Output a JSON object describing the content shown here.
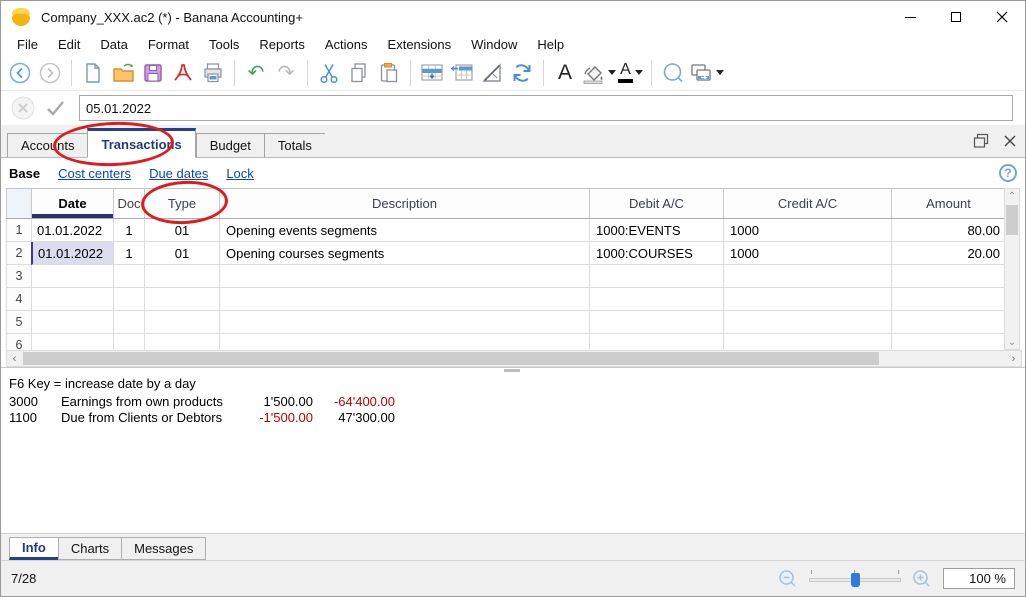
{
  "window": {
    "title": "Company_XXX.ac2 (*) - Banana Accounting+"
  },
  "menu": {
    "items": [
      "File",
      "Edit",
      "Data",
      "Format",
      "Tools",
      "Reports",
      "Actions",
      "Extensions",
      "Window",
      "Help"
    ]
  },
  "toolbar": {
    "font_label": "A",
    "font_color_label": "A"
  },
  "icons": {
    "undo": "↶",
    "redo": "↷",
    "scroll_up": "⌃",
    "scroll_down": "⌄",
    "scroll_left": "‹",
    "scroll_right": "›",
    "help": "?"
  },
  "edit_bar": {
    "value": "05.01.2022"
  },
  "main_tabs": {
    "active": "Transactions",
    "items": [
      {
        "label": "Accounts"
      },
      {
        "label": "Transactions"
      },
      {
        "label": "Budget"
      },
      {
        "label": "Totals"
      }
    ]
  },
  "views_bar": {
    "active": "Base",
    "links": [
      {
        "label": "Cost centers"
      },
      {
        "label": "Due dates"
      },
      {
        "label": "Lock"
      }
    ]
  },
  "transactions_table": {
    "columns": {
      "date": "Date",
      "doc": "Doc",
      "type": "Type",
      "description": "Description",
      "debit": "Debit A/C",
      "credit": "Credit A/C",
      "amount": "Amount"
    },
    "rows": [
      {
        "num": "1",
        "date": "01.01.2022",
        "doc": "1",
        "type": "01",
        "description": "Opening events segments",
        "debit": "1000:EVENTS",
        "credit": "1000",
        "amount": "80.00"
      },
      {
        "num": "2",
        "date": "01.01.2022",
        "doc": "1",
        "type": "01",
        "description": "Opening courses segments",
        "debit": "1000:COURSES",
        "credit": "1000",
        "amount": "20.00"
      },
      {
        "num": "3",
        "date": "",
        "doc": "",
        "type": "",
        "description": "",
        "debit": "",
        "credit": "",
        "amount": ""
      },
      {
        "num": "4",
        "date": "",
        "doc": "",
        "type": "",
        "description": "",
        "debit": "",
        "credit": "",
        "amount": ""
      },
      {
        "num": "5",
        "date": "",
        "doc": "",
        "type": "",
        "description": "",
        "debit": "",
        "credit": "",
        "amount": ""
      },
      {
        "num": "6",
        "date": "",
        "doc": "",
        "type": "",
        "description": "",
        "debit": "",
        "credit": "",
        "amount": ""
      }
    ]
  },
  "info_panel": {
    "hint": "F6 Key = increase date by a day",
    "accounts": [
      {
        "account": "3000",
        "description": "Earnings from own products",
        "amount1": "1'500.00",
        "amount1_class": "black",
        "amount2": "-64'400.00",
        "amount2_class": "red"
      },
      {
        "account": "1100",
        "description": "Due from Clients or Debtors",
        "amount1": "-1'500.00",
        "amount1_class": "red",
        "amount2": "47'300.00",
        "amount2_class": "black"
      }
    ]
  },
  "bottom_tabs": {
    "active": "Info",
    "items": [
      {
        "label": "Info"
      },
      {
        "label": "Charts"
      },
      {
        "label": "Messages"
      }
    ]
  },
  "status_bar": {
    "row_position": "7/28",
    "zoom_level": "100 %"
  },
  "colors": {
    "annotation_red": "#e01b1b",
    "link_blue": "#0a43c9",
    "active_tab_blue": "#1f3a8c",
    "negative_red": "#c00000",
    "selected_cell_bg": "#dcdcef"
  }
}
